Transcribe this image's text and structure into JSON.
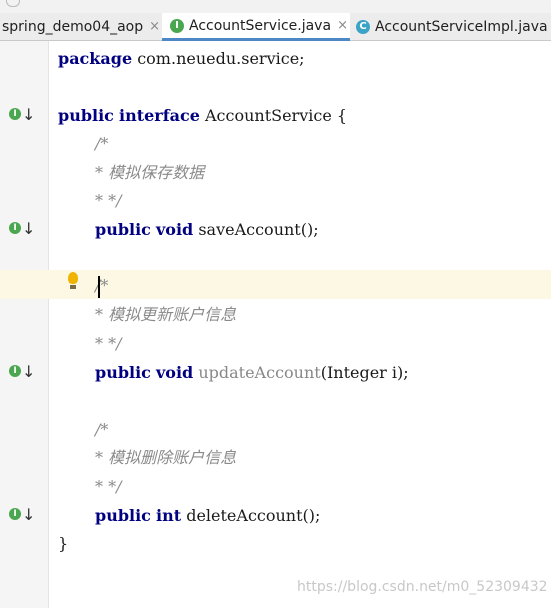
{
  "tabs": [
    {
      "label": "spring_demo04_aop",
      "icon": "",
      "active": false
    },
    {
      "label": "AccountService.java",
      "icon": "I",
      "active": true
    },
    {
      "label": "AccountServiceImpl.java",
      "icon": "C",
      "active": false
    }
  ],
  "tab_close_glyph": "×",
  "code": {
    "l1": {
      "kw": "package",
      "rest": " com.neuedu.service;"
    },
    "l2": {
      "kw1": "public",
      "kw2": "interface",
      "rest": " AccountService {"
    },
    "c1a": "/*",
    "c1b": "* 模拟保存数据",
    "c1c": "* */",
    "m1": {
      "kw1": "public",
      "kw2": "void",
      "rest": " saveAccount();"
    },
    "c2a": "/*",
    "c2b": "* 模拟更新账户信息",
    "c2c": "* */",
    "m2": {
      "kw1": "public",
      "kw2": "void",
      "name": "updateAccount",
      "rest": "(Integer i);"
    },
    "c3a": "/*",
    "c3b": "* 模拟删除账户信息",
    "c3c": "* */",
    "m3": {
      "kw1": "public",
      "kw2": "int",
      "rest": " deleteAccount();"
    },
    "close": "}"
  },
  "gutter_icon_letter": "I",
  "gutter_arrow": "↓",
  "watermark": "https://blog.csdn.net/m0_52309432",
  "colors": {
    "keyword": "#000080",
    "comment": "#8a8a8a",
    "current_line": "#fcf8e4",
    "tab_underline": "#4e87c6",
    "interface_icon": "#4aa64f",
    "class_icon": "#3aa3c6"
  }
}
